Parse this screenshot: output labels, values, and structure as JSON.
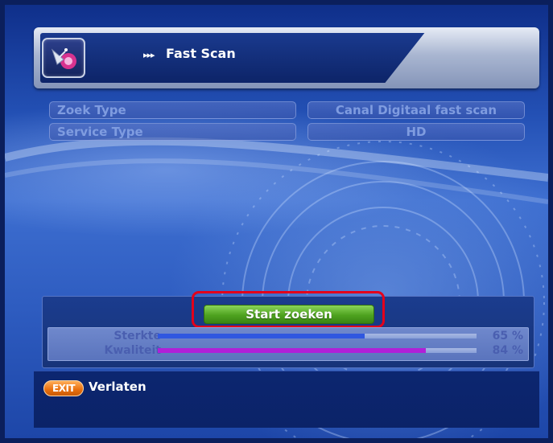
{
  "header": {
    "title_prefix": "▸▸▸",
    "title": "Fast Scan",
    "icon": "satellite-dish-icon"
  },
  "settings": [
    {
      "label": "Zoek Type",
      "value": "Canal Digitaal fast scan"
    },
    {
      "label": "Service Type",
      "value": "HD"
    }
  ],
  "scan": {
    "start_label": "Start zoeken",
    "signals": [
      {
        "label": "Sterkte",
        "percent": 65,
        "percent_text": "65 %",
        "color": "#2f57e0"
      },
      {
        "label": "Kwaliteit",
        "percent": 84,
        "percent_text": "84 %",
        "color": "#b020d8"
      }
    ]
  },
  "footer": {
    "exit_key": "EXIT",
    "exit_label": "Verlaten"
  },
  "colors": {
    "background": "#2a58c0",
    "button_green": "#4ea21f",
    "highlight_red": "#e3001b",
    "exit_orange": "#e86f0e"
  }
}
